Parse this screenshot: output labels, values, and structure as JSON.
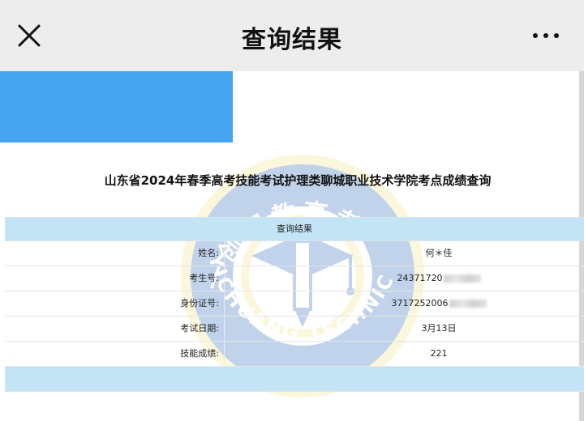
{
  "navbar": {
    "title": "查询结果",
    "close_icon": "close-icon",
    "more_icon": "more-icon"
  },
  "content": {
    "title": "山东省2024年春季高考技能考试护理类聊城职业技术学院考点成绩查询"
  },
  "watermark": {
    "top_text": "一创职教高考",
    "bottom_text": "YICHUANG TECHNICAL SCHOOL"
  },
  "table": {
    "header": "查询结果",
    "rows": [
      {
        "label": "姓名:",
        "value": "何＊佳",
        "masked": false
      },
      {
        "label": "考生号:",
        "value": "24371720",
        "masked": true
      },
      {
        "label": "身份证号:",
        "value": "3717252006",
        "masked": true
      },
      {
        "label": "考试日期:",
        "value": "3月13日",
        "masked": false
      },
      {
        "label": "技能成绩:",
        "value": "221",
        "masked": false
      }
    ]
  },
  "colors": {
    "navbar_bg": "#ededed",
    "banner_blue": "#45a4ee",
    "table_header_bg": "#c3e4f5"
  }
}
